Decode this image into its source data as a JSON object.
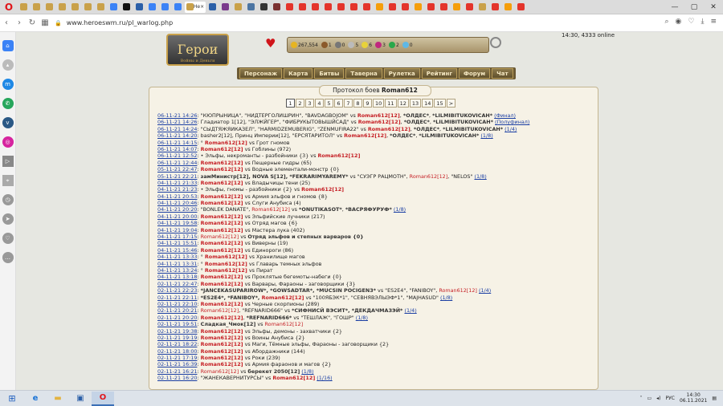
{
  "browser": {
    "tab_title": "He",
    "close": "×",
    "url": "www.heroeswm.ru/pl_warlog.php",
    "tab_colors": [
      "#c9a14a",
      "#c9a14a",
      "#c9a14a",
      "#c9a14a",
      "#c9a14a",
      "#c9a14a",
      "#c9a14a",
      "#3b82f6",
      "#111111",
      "#2b5fa8",
      "#3b82f6",
      "#3b82f6",
      "#3b82f6",
      "#2b5fa8",
      "#7a3a8c",
      "#c9a14a",
      "#4c75a3",
      "#333333",
      "#7a3030",
      "#e4342b",
      "#e4342b",
      "#e4342b",
      "#e4342b",
      "#e4342b",
      "#e4342b",
      "#e4342b",
      "#f59e0b",
      "#e4342b",
      "#e4342b",
      "#f59e0b",
      "#e4342b",
      "#e4342b",
      "#f59e0b",
      "#e4342b",
      "#c9a14a",
      "#e4342b",
      "#f59e0b",
      "#e4342b"
    ]
  },
  "game": {
    "logo": "Герои",
    "logo_sub": "Войны и Деньги",
    "online": "14:30, 4333 online",
    "resources": [
      "267,554",
      "1",
      "0",
      "5",
      "6",
      "3",
      "2",
      "0"
    ],
    "menu": [
      "Персонаж",
      "Карта",
      "Битвы",
      "Таверна",
      "Рулетка",
      "Рейтинг",
      "Форум",
      "Чат"
    ]
  },
  "panel": {
    "title_prefix": "Протокол боев",
    "title_name": "Roman612",
    "pages": [
      "1",
      "2",
      "3",
      "4",
      "5",
      "6",
      "7",
      "8",
      "9",
      "10",
      "11",
      "12",
      "13",
      "14",
      "15",
      ">"
    ],
    "rows": [
      [
        [
          "d",
          "06-11-21 14:26"
        ],
        [
          "t",
          ": \"КЮПРЫНИЦА\", \"НИДТЕРГОЛИШРИН\", \"BAVDAGBOJOM\" vs "
        ],
        [
          "nb",
          "Roman612[12]"
        ],
        [
          "t",
          ", "
        ],
        [
          "tb",
          "*ОЛДЕС*"
        ],
        [
          "t",
          ", "
        ],
        [
          "tb",
          "*LILMIBITUKOVICAH*"
        ],
        [
          "t",
          "   "
        ],
        [
          "lk",
          "(Финал)"
        ]
      ],
      [
        [
          "d",
          "06-11-21 14:26"
        ],
        [
          "t",
          ": Гладиатор 1[12], \"ЭЛЖЙГЕР\", \"ФИБРУКЫТОВЫШЙСАД\" vs "
        ],
        [
          "nb",
          "Roman612[12]"
        ],
        [
          "t",
          ", "
        ],
        [
          "tb",
          "*ОЛДЕС*"
        ],
        [
          "t",
          ", "
        ],
        [
          "tb",
          "*LILMIBITUKOVICAH*"
        ],
        [
          "t",
          "   "
        ],
        [
          "lk",
          "(Полуфинал)"
        ]
      ],
      [
        [
          "d",
          "06-11-21 14:24"
        ],
        [
          "t",
          ": \"СЫДТЯЖЯИКАЗЕЛ\", \"HARMIDZEMUBERIG\", \"ZENMUFIRA22\" vs "
        ],
        [
          "nb",
          "Roman612[12]"
        ],
        [
          "t",
          ", "
        ],
        [
          "tb",
          "*ОЛДЕС*"
        ],
        [
          "t",
          ", "
        ],
        [
          "tb",
          "*LILMIBITUKOVICAH*"
        ],
        [
          "t",
          "   "
        ],
        [
          "lk",
          "(1/4)"
        ]
      ],
      [
        [
          "d",
          "06-11-21 14:20"
        ],
        [
          "t",
          ": basher2[12], Принц Империи[12], \"ЕРСЯТАРИТОЛ\" vs "
        ],
        [
          "nb",
          "Roman612[12]"
        ],
        [
          "t",
          ", "
        ],
        [
          "tb",
          "*ОЛДЕС*"
        ],
        [
          "t",
          ", "
        ],
        [
          "tb",
          "*LILMIBITUKOVICAH*"
        ],
        [
          "t",
          "   "
        ],
        [
          "lk",
          "(1/8)"
        ]
      ],
      [
        [
          "d",
          "06-11-21 14:15"
        ],
        [
          "t",
          ": ° "
        ],
        [
          "nb",
          "Roman612[12]"
        ],
        [
          "t",
          " vs Грот гномов"
        ]
      ],
      [
        [
          "d",
          "06-11-21 14:07"
        ],
        [
          "t",
          ": "
        ],
        [
          "nb",
          "Roman612[12]"
        ],
        [
          "t",
          " vs Гоблины (972)"
        ]
      ],
      [
        [
          "d",
          "06-11-21 12:52"
        ],
        [
          "t",
          ": • Эльфы, некроманты - разбойники {3} vs "
        ],
        [
          "nb",
          "Roman612[12]"
        ]
      ],
      [
        [
          "d",
          "06-11-21 12:44"
        ],
        [
          "t",
          ": "
        ],
        [
          "nb",
          "Roman612[12]"
        ],
        [
          "t",
          " vs Пещерные гидры (65)"
        ]
      ],
      [
        [
          "d",
          "05-11-21 22:47"
        ],
        [
          "t",
          ": "
        ],
        [
          "nb",
          "Roman612[12]"
        ],
        [
          "t",
          " vs Водные элементали-монстр {0}"
        ]
      ],
      [
        [
          "d",
          "05-11-21 22:21"
        ],
        [
          "t",
          ": "
        ],
        [
          "tb",
          "замМинистр[12], NOVA S[12], *FEKRARIMYAREMY*"
        ],
        [
          "t",
          " vs \"СУЭГР РАЦМОТН\", "
        ],
        [
          "n",
          "Roman612[12]"
        ],
        [
          "t",
          ", \"NELOS\"   "
        ],
        [
          "lk",
          "(1/8)"
        ]
      ],
      [
        [
          "d",
          "04-11-21 21:33"
        ],
        [
          "t",
          ": "
        ],
        [
          "nb",
          "Roman612[12]"
        ],
        [
          "t",
          " vs Владычицы тени (25)"
        ]
      ],
      [
        [
          "d",
          "04-11-21 21:23"
        ],
        [
          "t",
          ": • Эльфы, гномы - разбойники {2} vs "
        ],
        [
          "nb",
          "Roman612[12]"
        ]
      ],
      [
        [
          "d",
          "04-11-21 20:53"
        ],
        [
          "t",
          ": "
        ],
        [
          "nb",
          "Roman612[12]"
        ],
        [
          "t",
          " vs Армия эльфов и гномов {8}"
        ]
      ],
      [
        [
          "d",
          "04-11-21 20:46"
        ],
        [
          "t",
          ": "
        ],
        [
          "nb",
          "Roman612[12]"
        ],
        [
          "t",
          " vs Слуги Анубиса (4)"
        ]
      ],
      [
        [
          "d",
          "04-11-21 20:20"
        ],
        [
          "t",
          ": \"BONLEK DANATE\", "
        ],
        [
          "n",
          "Roman612[12]"
        ],
        [
          "t",
          " vs "
        ],
        [
          "tb",
          "*ONUTIKASOT*"
        ],
        [
          "t",
          ", "
        ],
        [
          "tb",
          "*ВАСРЯФУРУФ*"
        ],
        [
          "t",
          "   "
        ],
        [
          "lk",
          "(1/8)"
        ]
      ],
      [
        [
          "d",
          "04-11-21 20:00"
        ],
        [
          "t",
          ": "
        ],
        [
          "nb",
          "Roman612[12]"
        ],
        [
          "t",
          " vs Эльфийские лучники (217)"
        ]
      ],
      [
        [
          "d",
          "04-11-21 19:58"
        ],
        [
          "t",
          ": "
        ],
        [
          "nb",
          "Roman612[12]"
        ],
        [
          "t",
          " vs Отряд магов {6}"
        ]
      ],
      [
        [
          "d",
          "04-11-21 19:04"
        ],
        [
          "t",
          ": "
        ],
        [
          "nb",
          "Roman612[12]"
        ],
        [
          "t",
          " vs Мастера лука (402)"
        ]
      ],
      [
        [
          "d",
          "04-11-21 17:15"
        ],
        [
          "t",
          ": "
        ],
        [
          "n",
          "Roman612[12]"
        ],
        [
          "t",
          " vs "
        ],
        [
          "tb",
          "Отряд эльфов и степных варваров {0}"
        ]
      ],
      [
        [
          "d",
          "04-11-21 15:51"
        ],
        [
          "t",
          ": "
        ],
        [
          "nb",
          "Roman612[12]"
        ],
        [
          "t",
          " vs Виверны (19)"
        ]
      ],
      [
        [
          "d",
          "04-11-21 15:46"
        ],
        [
          "t",
          ": "
        ],
        [
          "nb",
          "Roman612[12]"
        ],
        [
          "t",
          " vs Единороги (86)"
        ]
      ],
      [
        [
          "d",
          "04-11-21 13:33"
        ],
        [
          "t",
          ": ° "
        ],
        [
          "nb",
          "Roman612[12]"
        ],
        [
          "t",
          " vs Хранилище магов"
        ]
      ],
      [
        [
          "d",
          "04-11-21 13:31"
        ],
        [
          "t",
          ": ° "
        ],
        [
          "nb",
          "Roman612[12]"
        ],
        [
          "t",
          " vs Главарь темных эльфов"
        ]
      ],
      [
        [
          "d",
          "04-11-21 13:24"
        ],
        [
          "t",
          ": ° "
        ],
        [
          "nb",
          "Roman612[12]"
        ],
        [
          "t",
          " vs Пират"
        ]
      ],
      [
        [
          "d",
          "04-11-21 13:18"
        ],
        [
          "t",
          ": "
        ],
        [
          "nb",
          "Roman612[12]"
        ],
        [
          "t",
          " vs Проклятые бегемоты-набеги {0}"
        ]
      ],
      [
        [
          "d",
          "02-11-21 22:47"
        ],
        [
          "t",
          ": "
        ],
        [
          "nb",
          "Roman612[12]"
        ],
        [
          "t",
          " vs Варвары, Фараоны - заговорщики {3}"
        ]
      ],
      [
        [
          "d",
          "02-11-21 22:23"
        ],
        [
          "t",
          ": "
        ],
        [
          "tb",
          "*JANCEKASUPARIROW*, *GOWSADTAR*, *MUCSIN POCIGEN3*"
        ],
        [
          "t",
          " vs \"ES2E4\", \"FANIBOY\", "
        ],
        [
          "n",
          "Roman612[12]"
        ],
        [
          "t",
          "   "
        ],
        [
          "lk",
          "(1/4)"
        ]
      ],
      [
        [
          "d",
          "02-11-21 22:11"
        ],
        [
          "t",
          ": "
        ],
        [
          "tb",
          "*ES2E4*, *FANIBOY*, "
        ],
        [
          "nb",
          "Roman612[12]"
        ],
        [
          "t",
          " vs \"100ЯБЭК*1\", \"СЕВНЯВЭЛЫЭФ*1\", \"MAJHASUD\"   "
        ],
        [
          "lk",
          "(1/8)"
        ]
      ],
      [
        [
          "d",
          "02-11-21 22:10"
        ],
        [
          "t",
          ": "
        ],
        [
          "nb",
          "Roman612[12]"
        ],
        [
          "t",
          " vs Черные скорпионы (289)"
        ]
      ],
      [
        [
          "d",
          "02-11-21 20:21"
        ],
        [
          "t",
          ": "
        ],
        [
          "n",
          "Roman612[12]"
        ],
        [
          "t",
          ", \"REFNARID666\" vs "
        ],
        [
          "tb",
          "*СИФНИСЙ ВЭСИТ*, *ДЕКДАЧМАЗЭЙ*"
        ],
        [
          "t",
          "   "
        ],
        [
          "lk",
          "(1/4)"
        ]
      ],
      [
        [
          "d",
          "02-11-21 20:20"
        ],
        [
          "t",
          ": "
        ],
        [
          "nb",
          "Roman612[12]"
        ],
        [
          "t",
          ", "
        ],
        [
          "tb",
          "*REFNARID666*"
        ],
        [
          "t",
          " vs \"ТЕШЛАЖ\", \"ГОШР\"   "
        ],
        [
          "lk",
          "(1/8)"
        ]
      ],
      [
        [
          "d",
          "02-11-21 19:51"
        ],
        [
          "t",
          ": "
        ],
        [
          "tb",
          "Сладкая_Чмок[12]"
        ],
        [
          "t",
          " vs "
        ],
        [
          "n",
          "Roman612[12]"
        ]
      ],
      [
        [
          "d",
          "02-11-21 19:38"
        ],
        [
          "t",
          ": "
        ],
        [
          "nb",
          "Roman612[12]"
        ],
        [
          "t",
          " vs Эльфы, демоны - захватчики {2}"
        ]
      ],
      [
        [
          "d",
          "02-11-21 19:19"
        ],
        [
          "t",
          ": "
        ],
        [
          "nb",
          "Roman612[12]"
        ],
        [
          "t",
          " vs Воины Анубиса {2}"
        ]
      ],
      [
        [
          "d",
          "02-11-21 18:22"
        ],
        [
          "t",
          ": "
        ],
        [
          "nb",
          "Roman612[12]"
        ],
        [
          "t",
          " vs Маги, Тёмные эльфы, Фараоны - заговорщики {2}"
        ]
      ],
      [
        [
          "d",
          "02-11-21 18:00"
        ],
        [
          "t",
          ": "
        ],
        [
          "nb",
          "Roman612[12]"
        ],
        [
          "t",
          " vs Абордажники (144)"
        ]
      ],
      [
        [
          "d",
          "02-11-21 17:19"
        ],
        [
          "t",
          ": "
        ],
        [
          "nb",
          "Roman612[12]"
        ],
        [
          "t",
          " vs Роки (239)"
        ]
      ],
      [
        [
          "d",
          "02-11-21 16:39"
        ],
        [
          "t",
          ": "
        ],
        [
          "nb",
          "Roman612[12]"
        ],
        [
          "t",
          " vs Армия фараонов и магов {2}"
        ]
      ],
      [
        [
          "d",
          "02-11-21 16:21"
        ],
        [
          "t",
          ": "
        ],
        [
          "n",
          "Roman612[12]"
        ],
        [
          "t",
          " vs "
        ],
        [
          "tb",
          "берекет 2050[12]"
        ],
        [
          "t",
          "   "
        ],
        [
          "lk",
          "(1/8)"
        ]
      ],
      [
        [
          "d",
          "02-11-21 16:20"
        ],
        [
          "t",
          ": \"ЖАНЕКАВЕРНИТУРСЫ\" vs "
        ],
        [
          "nb",
          "Roman612[12]"
        ],
        [
          "t",
          "   "
        ],
        [
          "lk",
          "(1/16)"
        ]
      ]
    ]
  },
  "taskbar": {
    "lang": "РУС",
    "time": "14:30",
    "date": "06.11.2021"
  }
}
